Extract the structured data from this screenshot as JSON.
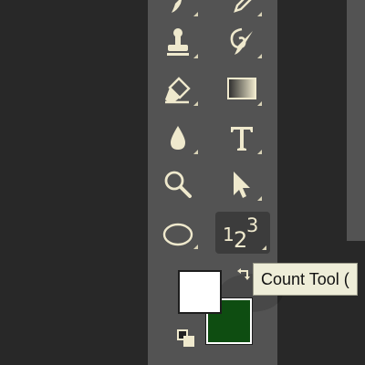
{
  "toolbar": {
    "tools": [
      {
        "name": "brush-tool",
        "icon": "brush-icon"
      },
      {
        "name": "pencil-tool",
        "icon": "pencil-icon"
      },
      {
        "name": "clone-stamp-tool",
        "icon": "stamp-icon"
      },
      {
        "name": "art-history-brush-tool",
        "icon": "art-history-brush-icon"
      },
      {
        "name": "eraser-tool",
        "icon": "eraser-icon"
      },
      {
        "name": "gradient-tool",
        "icon": "gradient-icon"
      },
      {
        "name": "blur-tool",
        "icon": "drop-icon"
      },
      {
        "name": "type-tool",
        "icon": "type-icon"
      },
      {
        "name": "zoom-tool",
        "icon": "magnifier-icon"
      },
      {
        "name": "path-selection-tool",
        "icon": "arrow-cursor-icon"
      },
      {
        "name": "ellipse-tool",
        "icon": "ellipse-icon"
      },
      {
        "name": "count-tool",
        "icon": "count-123-icon",
        "selected": true
      }
    ],
    "count_tool_glyphs": {
      "one": "1",
      "two": "2",
      "three": "3"
    }
  },
  "colors": {
    "foreground": "#ffffff",
    "background": "#0e4d11",
    "toolbar_bg": "#535353",
    "icon": "#efe9cd"
  },
  "tooltip": {
    "text": "Count Tool ("
  }
}
